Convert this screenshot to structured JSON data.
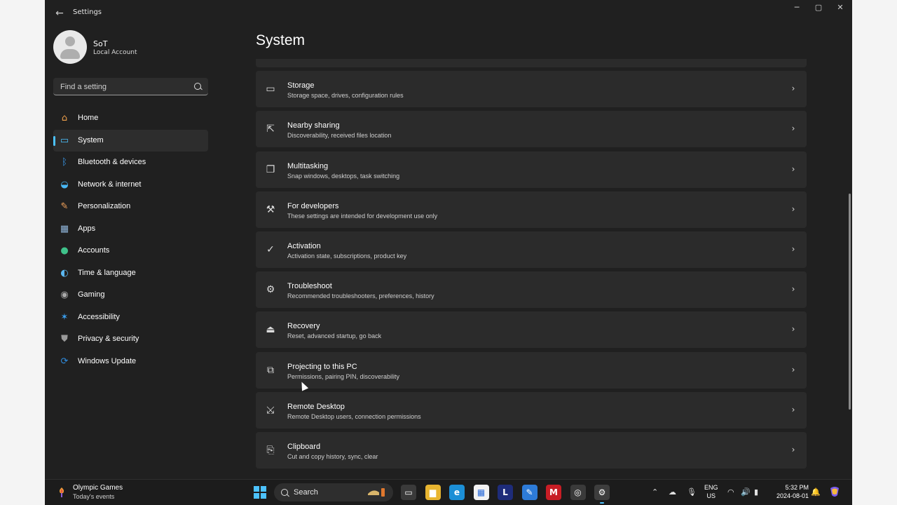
{
  "window": {
    "title": "Settings",
    "back_icon": "back-arrow-icon",
    "controls": {
      "minimize": "─",
      "maximize": "▢",
      "close": "✕"
    }
  },
  "user": {
    "name": "SoT",
    "account": "Local Account"
  },
  "search": {
    "placeholder": "Find a setting"
  },
  "sidebar": {
    "items": [
      {
        "label": "Home",
        "icon": "home-icon",
        "glyph": "⌂",
        "color": "#f0a04b",
        "active": false
      },
      {
        "label": "System",
        "icon": "system-icon",
        "glyph": "▭",
        "color": "#4cc2ff",
        "active": true
      },
      {
        "label": "Bluetooth & devices",
        "icon": "bluetooth-icon",
        "glyph": "ᛒ",
        "color": "#3a9cf0",
        "active": false
      },
      {
        "label": "Network & internet",
        "icon": "wifi-icon",
        "glyph": "◒",
        "color": "#49b8f5",
        "active": false
      },
      {
        "label": "Personalization",
        "icon": "brush-icon",
        "glyph": "✎",
        "color": "#f3a35b",
        "active": false
      },
      {
        "label": "Apps",
        "icon": "apps-icon",
        "glyph": "▦",
        "color": "#8fb4d9",
        "active": false
      },
      {
        "label": "Accounts",
        "icon": "accounts-icon",
        "glyph": "●",
        "color": "#3fc28a",
        "active": false
      },
      {
        "label": "Time & language",
        "icon": "globe-clock-icon",
        "glyph": "◐",
        "color": "#5bb8f2",
        "active": false
      },
      {
        "label": "Gaming",
        "icon": "gamepad-icon",
        "glyph": "◉",
        "color": "#a8a8a8",
        "active": false
      },
      {
        "label": "Accessibility",
        "icon": "accessibility-icon",
        "glyph": "✶",
        "color": "#3aa0f2",
        "active": false
      },
      {
        "label": "Privacy & security",
        "icon": "shield-icon",
        "glyph": "⛊",
        "color": "#9a9a9a",
        "active": false
      },
      {
        "label": "Windows Update",
        "icon": "update-icon",
        "glyph": "⟳",
        "color": "#2f8de0",
        "active": false
      }
    ]
  },
  "main": {
    "title": "System",
    "items": [
      {
        "title": "",
        "subtitle": "",
        "icon": "partial-item-icon",
        "glyph": ""
      },
      {
        "title": "Storage",
        "subtitle": "Storage space, drives, configuration rules",
        "icon": "storage-icon",
        "glyph": "▭"
      },
      {
        "title": "Nearby sharing",
        "subtitle": "Discoverability, received files location",
        "icon": "share-icon",
        "glyph": "⇱"
      },
      {
        "title": "Multitasking",
        "subtitle": "Snap windows, desktops, task switching",
        "icon": "multitasking-icon",
        "glyph": "❐"
      },
      {
        "title": "For developers",
        "subtitle": "These settings are intended for development use only",
        "icon": "developer-tools-icon",
        "glyph": "⚒"
      },
      {
        "title": "Activation",
        "subtitle": "Activation state, subscriptions, product key",
        "icon": "check-circle-icon",
        "glyph": "✓"
      },
      {
        "title": "Troubleshoot",
        "subtitle": "Recommended troubleshooters, preferences, history",
        "icon": "wrench-icon",
        "glyph": "⚙"
      },
      {
        "title": "Recovery",
        "subtitle": "Reset, advanced startup, go back",
        "icon": "recovery-icon",
        "glyph": "⏏"
      },
      {
        "title": "Projecting to this PC",
        "subtitle": "Permissions, pairing PIN, discoverability",
        "icon": "projecting-icon",
        "glyph": "⧉"
      },
      {
        "title": "Remote Desktop",
        "subtitle": "Remote Desktop users, connection permissions",
        "icon": "remote-desktop-icon",
        "glyph": "⤩"
      },
      {
        "title": "Clipboard",
        "subtitle": "Cut and copy history, sync, clear",
        "icon": "clipboard-icon",
        "glyph": "⎘"
      }
    ]
  },
  "taskbar": {
    "widget_title": "Olympic Games",
    "widget_subtitle": "Today's events",
    "search_label": "Search",
    "apps": [
      {
        "name": "taskview-app",
        "glyph": "▭",
        "bg": "#3a3a3a"
      },
      {
        "name": "file-explorer-app",
        "glyph": "▆",
        "bg": "#e8b530"
      },
      {
        "name": "edge-app",
        "glyph": "e",
        "bg": "#1c8fd6"
      },
      {
        "name": "store-app",
        "glyph": "▦",
        "bg": "#f2f2f2"
      },
      {
        "name": "l-app",
        "glyph": "L",
        "bg": "#1e2c7a"
      },
      {
        "name": "pen-app",
        "glyph": "✎",
        "bg": "#2d7bd8"
      },
      {
        "name": "mcafee-app",
        "glyph": "M",
        "bg": "#c81d25"
      },
      {
        "name": "chrome-app",
        "glyph": "◎",
        "bg": "#3a3a3a"
      },
      {
        "name": "settings-app",
        "glyph": "⚙",
        "bg": "#3d3d3d",
        "active": true
      }
    ],
    "lang_line1": "ENG",
    "lang_line2": "US",
    "time": "5:32 PM",
    "date": "2024-08-01"
  }
}
